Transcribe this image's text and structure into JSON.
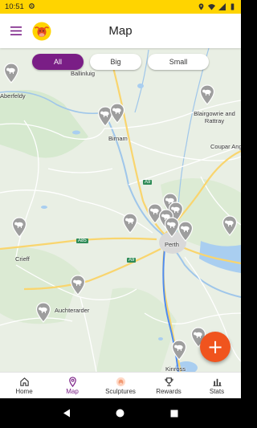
{
  "status_bar": {
    "time": "10:51"
  },
  "app_bar": {
    "title": "Map"
  },
  "filters": [
    {
      "label": "All",
      "active": true
    },
    {
      "label": "Big",
      "active": false
    },
    {
      "label": "Small",
      "active": false
    }
  ],
  "map_labels": {
    "aberfeldy": "Aberfeldy",
    "ballinluig": "Ballinluig",
    "blairgowrie": "Blairgowrie and Rattray",
    "birnam": "Birnam",
    "coupar": "Coupar Angus",
    "crieff": "Crieff",
    "perth": "Perth",
    "auchterarder": "Auchterarder",
    "kinross": "Kinross"
  },
  "road_labels": {
    "a9_north": "A9",
    "a85": "A85",
    "a9_south": "A9"
  },
  "fab": {
    "label": "+"
  },
  "bottom_nav": {
    "home": "Home",
    "map": "Map",
    "sculptures": "Sculptures",
    "rewards": "Rewards",
    "stats": "Stats"
  },
  "colors": {
    "status_bar": "#FFD400",
    "accent": "#7A1E86",
    "fab": "#F0541E",
    "pin": "#9E9E9E",
    "map_land": "#E9EFE4"
  }
}
